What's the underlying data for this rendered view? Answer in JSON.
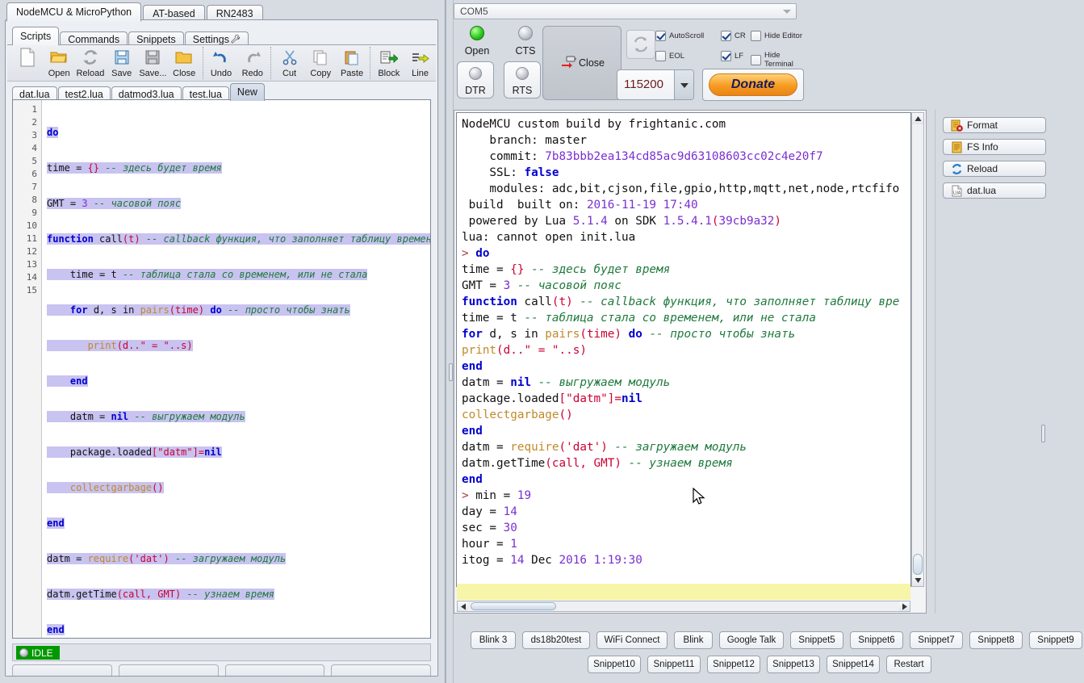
{
  "device_tabs": [
    {
      "label": "NodeMCU & MicroPython",
      "active": true
    },
    {
      "label": "AT-based",
      "active": false
    },
    {
      "label": "RN2483",
      "active": false
    }
  ],
  "section_tabs": [
    {
      "label": "Scripts",
      "active": true,
      "icon": ""
    },
    {
      "label": "Commands",
      "active": false,
      "icon": ""
    },
    {
      "label": "Snippets",
      "active": false,
      "icon": ""
    },
    {
      "label": "Settings",
      "active": false,
      "icon": "wrench-icon"
    }
  ],
  "toolbar": [
    {
      "label": "",
      "icon": "blank-page-icon"
    },
    {
      "label": "Open",
      "icon": "open-folder-icon"
    },
    {
      "label": "Reload",
      "icon": "reload-icon"
    },
    {
      "label": "Save",
      "icon": "floppy-save-icon"
    },
    {
      "label": "Save...",
      "icon": "save-as-icon"
    },
    {
      "label": "Close",
      "icon": "close-folder-icon"
    },
    {
      "label": "Undo",
      "icon": "undo-icon"
    },
    {
      "label": "Redo",
      "icon": "redo-icon"
    },
    {
      "label": "Cut",
      "icon": "scissors-icon"
    },
    {
      "label": "Copy",
      "icon": "copy-icon"
    },
    {
      "label": "Paste",
      "icon": "paste-icon"
    },
    {
      "label": "Block",
      "icon": "block-upload-icon"
    },
    {
      "label": "Line",
      "icon": "line-upload-icon"
    }
  ],
  "file_tabs": [
    {
      "label": "dat.lua",
      "active": false
    },
    {
      "label": "test2.lua",
      "active": false
    },
    {
      "label": "datmod3.lua",
      "active": false
    },
    {
      "label": "test.lua",
      "active": false
    },
    {
      "label": "New",
      "active": true
    }
  ],
  "editor": {
    "line_numbers": [
      "1",
      "2",
      "3",
      "4",
      "5",
      "6",
      "7",
      "8",
      "9",
      "10",
      "11",
      "12",
      "13",
      "14",
      "15"
    ],
    "lines": [
      "do",
      "time = {} -- здесь будет время",
      "GMT = 3 -- часовой пояс",
      "function call(t) -- callback функция, что заполняет таблицу времени",
      "    time = t -- таблица стала со временем, или не стала",
      "    for d, s in pairs(time) do -- просто чтобы знать",
      "       print(d..\" = \"..s)",
      "    end",
      "    datm = nil -- выгружаем модуль",
      "    package.loaded[\"datm\"]=nil",
      "    collectgarbage()",
      "end",
      "datm = require('dat') -- загружаем модуль",
      "datm.getTime(call, GMT) -- узнаем время",
      "end"
    ]
  },
  "status": {
    "badge": "IDLE"
  },
  "connection": {
    "port": "COM5",
    "leds": [
      {
        "label": "Open",
        "state": "green"
      },
      {
        "label": "CTS",
        "state": "grey"
      }
    ],
    "toggles": [
      {
        "label": "DTR",
        "state": "grey"
      },
      {
        "label": "RTS",
        "state": "grey"
      }
    ],
    "close_button": "Close",
    "refresh_icon": "refresh-icon",
    "baud": "115200",
    "donate": "Donate",
    "checkboxes": [
      {
        "label": "AutoScroll",
        "checked": true
      },
      {
        "label": "EOL",
        "checked": false
      },
      {
        "label": "CR",
        "checked": true
      },
      {
        "label": "LF",
        "checked": true
      },
      {
        "label": "Hide Editor",
        "checked": false
      },
      {
        "label": "Hide Terminal",
        "checked": false
      }
    ]
  },
  "terminal": {
    "input_value": "",
    "lines": [
      {
        "segments": [
          {
            "t": "NodeMCU custom build by frightanic.com",
            "c": "plain"
          }
        ]
      },
      {
        "segments": [
          {
            "t": "    branch: master",
            "c": "plain"
          }
        ]
      },
      {
        "segments": [
          {
            "t": "    commit: ",
            "c": "plain"
          },
          {
            "t": "7b83bbb2ea134cd85ac9d63108603cc02c4e20f7",
            "c": "num"
          }
        ]
      },
      {
        "segments": [
          {
            "t": "    SSL: ",
            "c": "plain"
          },
          {
            "t": "false",
            "c": "kw"
          }
        ]
      },
      {
        "segments": [
          {
            "t": "    modules: adc,bit,cjson,file,gpio,http,mqtt,net,node,rtcfifo",
            "c": "plain"
          }
        ]
      },
      {
        "segments": [
          {
            "t": " build  built on: ",
            "c": "plain"
          },
          {
            "t": "2016-11-19",
            "c": "num"
          },
          {
            "t": " ",
            "c": "plain"
          },
          {
            "t": "17:40",
            "c": "num"
          }
        ]
      },
      {
        "segments": [
          {
            "t": " powered by Lua ",
            "c": "plain"
          },
          {
            "t": "5.1.4",
            "c": "num"
          },
          {
            "t": " on SDK ",
            "c": "plain"
          },
          {
            "t": "1.5.4.1",
            "c": "num"
          },
          {
            "t": "(",
            "c": "pun"
          },
          {
            "t": "39cb9a32",
            "c": "num"
          },
          {
            "t": ")",
            "c": "pun"
          }
        ]
      },
      {
        "segments": [
          {
            "t": "lua: cannot open init.lua",
            "c": "plain"
          }
        ]
      },
      {
        "segments": [
          {
            "t": "> ",
            "c": "prompt"
          },
          {
            "t": "do",
            "c": "kw"
          }
        ]
      },
      {
        "segments": [
          {
            "t": "time = ",
            "c": "plain"
          },
          {
            "t": "{}",
            "c": "pun"
          },
          {
            "t": " ",
            "c": "plain"
          },
          {
            "t": "-- здесь будет время",
            "c": "cm"
          }
        ]
      },
      {
        "segments": [
          {
            "t": "GMT = ",
            "c": "plain"
          },
          {
            "t": "3",
            "c": "num"
          },
          {
            "t": " ",
            "c": "plain"
          },
          {
            "t": "-- часовой пояс",
            "c": "cm"
          }
        ]
      },
      {
        "segments": [
          {
            "t": "function",
            "c": "kw"
          },
          {
            "t": " call",
            "c": "plain"
          },
          {
            "t": "(t)",
            "c": "pun"
          },
          {
            "t": " ",
            "c": "plain"
          },
          {
            "t": "-- callback функция, что заполняет таблицу вре",
            "c": "cm"
          }
        ]
      },
      {
        "segments": [
          {
            "t": "time = t ",
            "c": "plain"
          },
          {
            "t": "-- таблица стала со временем, или не стала",
            "c": "cm"
          }
        ]
      },
      {
        "segments": [
          {
            "t": "for",
            "c": "kw"
          },
          {
            "t": " d, s in ",
            "c": "plain"
          },
          {
            "t": "pairs",
            "c": "fn"
          },
          {
            "t": "(time)",
            "c": "pun"
          },
          {
            "t": " ",
            "c": "plain"
          },
          {
            "t": "do",
            "c": "kw"
          },
          {
            "t": " ",
            "c": "plain"
          },
          {
            "t": "-- просто чтобы знать",
            "c": "cm"
          }
        ]
      },
      {
        "segments": [
          {
            "t": "print",
            "c": "fn"
          },
          {
            "t": "(d..",
            "c": "pun"
          },
          {
            "t": "\" = \"",
            "c": "str"
          },
          {
            "t": "..s)",
            "c": "pun"
          }
        ]
      },
      {
        "segments": [
          {
            "t": "end",
            "c": "kw"
          }
        ]
      },
      {
        "segments": [
          {
            "t": "datm = ",
            "c": "plain"
          },
          {
            "t": "nil",
            "c": "kw"
          },
          {
            "t": " ",
            "c": "plain"
          },
          {
            "t": "-- выгружаем модуль",
            "c": "cm"
          }
        ]
      },
      {
        "segments": [
          {
            "t": "package.loaded",
            "c": "plain"
          },
          {
            "t": "[",
            "c": "pun"
          },
          {
            "t": "\"datm\"",
            "c": "str"
          },
          {
            "t": "]=",
            "c": "pun"
          },
          {
            "t": "nil",
            "c": "kw"
          }
        ]
      },
      {
        "segments": [
          {
            "t": "collectgarbage",
            "c": "fn"
          },
          {
            "t": "()",
            "c": "pun"
          }
        ]
      },
      {
        "segments": [
          {
            "t": "end",
            "c": "kw"
          }
        ]
      },
      {
        "segments": [
          {
            "t": "datm = ",
            "c": "plain"
          },
          {
            "t": "require",
            "c": "fn"
          },
          {
            "t": "(",
            "c": "pun"
          },
          {
            "t": "'dat'",
            "c": "str"
          },
          {
            "t": ")",
            "c": "pun"
          },
          {
            "t": " ",
            "c": "plain"
          },
          {
            "t": "-- загружаем модуль",
            "c": "cm"
          }
        ]
      },
      {
        "segments": [
          {
            "t": "datm.getTime",
            "c": "plain"
          },
          {
            "t": "(call, GMT)",
            "c": "pun"
          },
          {
            "t": " ",
            "c": "plain"
          },
          {
            "t": "-- узнаем время",
            "c": "cm"
          }
        ]
      },
      {
        "segments": [
          {
            "t": "end",
            "c": "kw"
          }
        ]
      },
      {
        "segments": [
          {
            "t": "> ",
            "c": "prompt"
          },
          {
            "t": "min = ",
            "c": "plain"
          },
          {
            "t": "19",
            "c": "num"
          }
        ]
      },
      {
        "segments": [
          {
            "t": "day = ",
            "c": "plain"
          },
          {
            "t": "14",
            "c": "num"
          }
        ]
      },
      {
        "segments": [
          {
            "t": "sec = ",
            "c": "plain"
          },
          {
            "t": "30",
            "c": "num"
          }
        ]
      },
      {
        "segments": [
          {
            "t": "hour = ",
            "c": "plain"
          },
          {
            "t": "1",
            "c": "num"
          }
        ]
      },
      {
        "segments": [
          {
            "t": "itog = ",
            "c": "plain"
          },
          {
            "t": "14",
            "c": "num"
          },
          {
            "t": " Dec ",
            "c": "plain"
          },
          {
            "t": "2016",
            "c": "num"
          },
          {
            "t": " ",
            "c": "plain"
          },
          {
            "t": "1:19:30",
            "c": "num"
          }
        ]
      }
    ]
  },
  "side_buttons": [
    {
      "label": "Format",
      "icon": "format-fs-icon"
    },
    {
      "label": "FS Info",
      "icon": "fs-info-icon"
    },
    {
      "label": "Reload",
      "icon": "reload-blue-icon"
    },
    {
      "label": "dat.lua",
      "icon": "lua-file-icon"
    }
  ],
  "snippets_row1": [
    "Blink 3",
    "ds18b20test",
    "WiFi Connect",
    "Blink",
    "Google Talk",
    "Snippet5",
    "Snippet6",
    "Snippet7",
    "Snippet8",
    "Snippet9"
  ],
  "snippets_row2": [
    "Snippet10",
    "Snippet11",
    "Snippet12",
    "Snippet13",
    "Snippet14",
    "Restart"
  ],
  "colors": {
    "keyword": "#0000d0",
    "comment": "#1f7a3d",
    "number": "#7a2fd0",
    "string": "#cc0033",
    "function": "#c08a2a",
    "selection": "#c8c3f0",
    "idle_badge": "#009900",
    "donate_orange": "#f79b20",
    "terminal_input": "#f7f5a8"
  }
}
